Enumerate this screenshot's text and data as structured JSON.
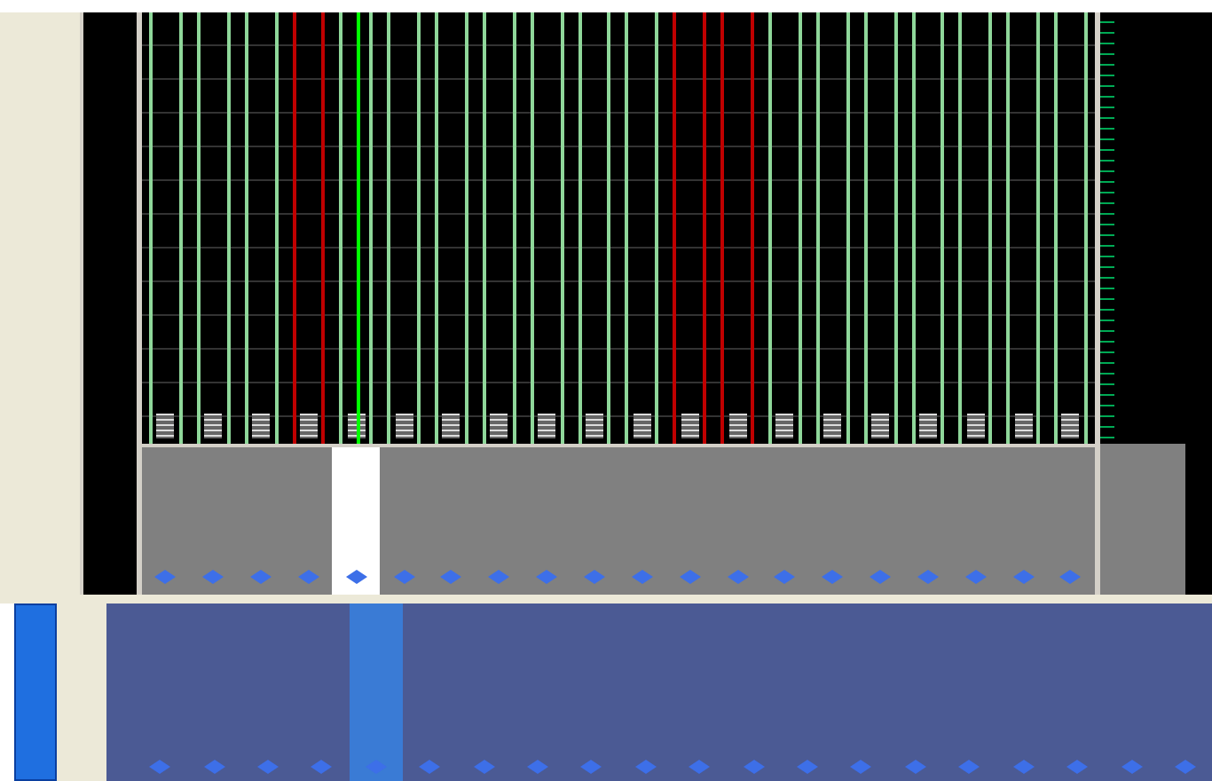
{
  "signals": [
    {
      "color": "#8fd79a",
      "selected": false
    },
    {
      "color": "#8fd79a",
      "selected": false
    },
    {
      "color": "#8fd79a",
      "selected": false
    },
    {
      "color": "#c00000",
      "selected": false
    },
    {
      "color": "#8fd79a",
      "selected": true
    },
    {
      "color": "#8fd79a",
      "selected": false
    },
    {
      "color": "#8fd79a",
      "selected": false
    },
    {
      "color": "#8fd79a",
      "selected": false
    },
    {
      "color": "#8fd79a",
      "selected": false
    },
    {
      "color": "#8fd79a",
      "selected": false
    },
    {
      "color": "#8fd79a",
      "selected": false
    },
    {
      "color": "#c00000",
      "selected": false
    },
    {
      "color": "#c00000",
      "selected": false
    },
    {
      "color": "#8fd79a",
      "selected": false
    },
    {
      "color": "#8fd79a",
      "selected": false
    },
    {
      "color": "#8fd79a",
      "selected": false
    },
    {
      "color": "#8fd79a",
      "selected": false
    },
    {
      "color": "#8fd79a",
      "selected": false
    },
    {
      "color": "#8fd79a",
      "selected": false
    },
    {
      "color": "#8fd79a",
      "selected": false
    }
  ]
}
